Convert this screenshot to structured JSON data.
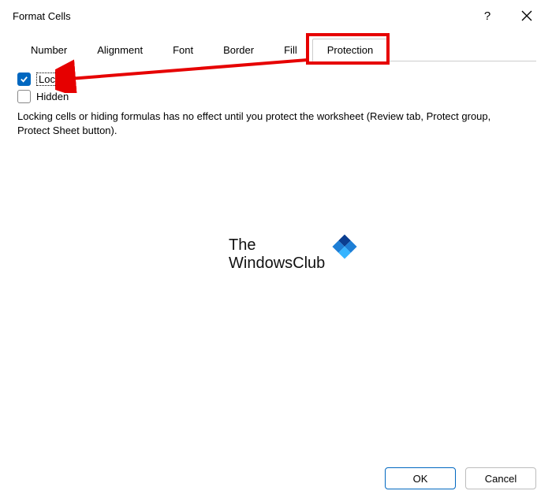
{
  "dialog": {
    "title": "Format Cells",
    "help_label": "?",
    "close_label": "Close"
  },
  "tabs": {
    "items": [
      {
        "label": "Number"
      },
      {
        "label": "Alignment"
      },
      {
        "label": "Font"
      },
      {
        "label": "Border"
      },
      {
        "label": "Fill"
      },
      {
        "label": "Protection"
      }
    ],
    "active_index": 5
  },
  "protection": {
    "locked_label": "Locked",
    "locked_checked": true,
    "hidden_label": "Hidden",
    "hidden_checked": false,
    "info_text": "Locking cells or hiding formulas has no effect until you protect the worksheet (Review tab, Protect group, Protect Sheet button)."
  },
  "watermark": {
    "line1": "The",
    "line2": "WindowsClub"
  },
  "buttons": {
    "ok": "OK",
    "cancel": "Cancel"
  },
  "annotation": {
    "highlight_color": "#e60000",
    "arrow_color": "#e60000"
  }
}
